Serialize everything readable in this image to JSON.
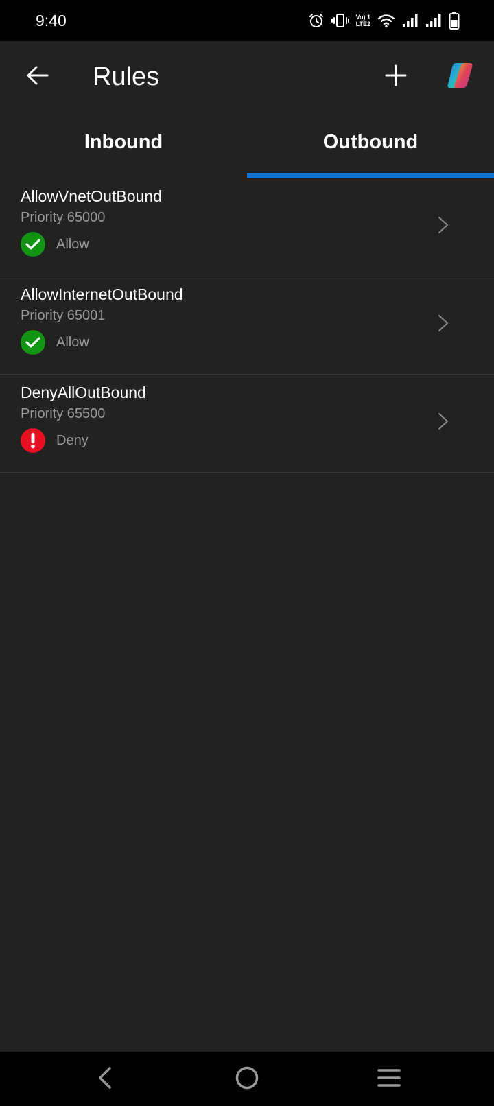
{
  "status_bar": {
    "time": "9:40",
    "network_label_top": "Vo) 1",
    "network_label_bottom": "LTE2"
  },
  "header": {
    "title": "Rules",
    "back_icon": "arrow-left-icon",
    "add_icon": "plus-icon",
    "copilot_icon": "copilot-icon"
  },
  "tabs": [
    {
      "label": "Inbound",
      "selected": false
    },
    {
      "label": "Outbound",
      "selected": true
    }
  ],
  "rules": [
    {
      "name": "AllowVnetOutBound",
      "priority": "Priority 65000",
      "action": "Allow",
      "status": "allow"
    },
    {
      "name": "AllowInternetOutBound",
      "priority": "Priority 65001",
      "action": "Allow",
      "status": "allow"
    },
    {
      "name": "DenyAllOutBound",
      "priority": "Priority 65500",
      "action": "Deny",
      "status": "deny"
    }
  ],
  "colors": {
    "background": "#222222",
    "accent": "#0a74d4",
    "allow": "#129512",
    "deny": "#e81123",
    "secondary_text": "#9a9a9a"
  }
}
